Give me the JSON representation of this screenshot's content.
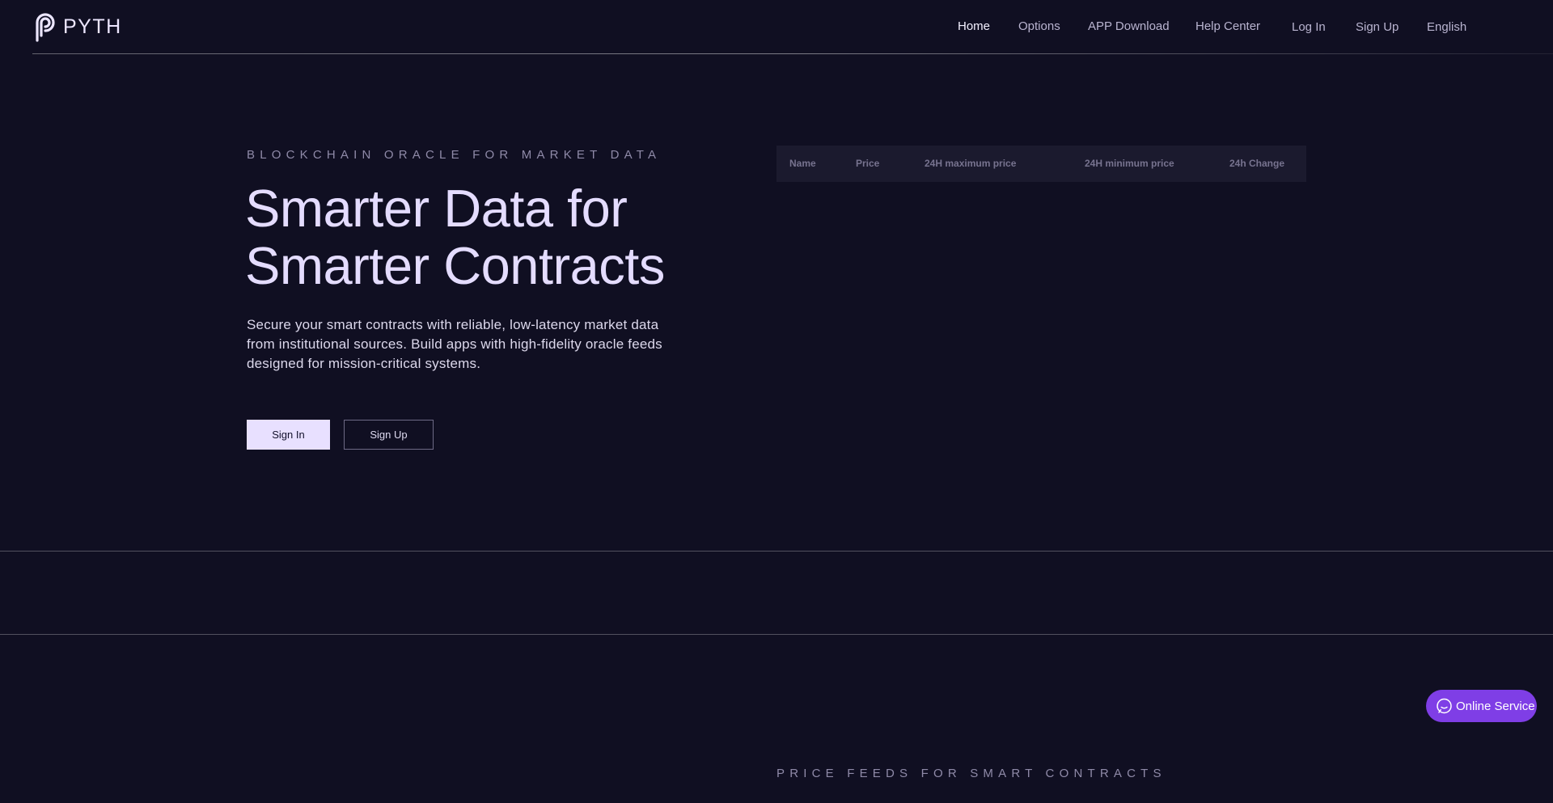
{
  "brand": {
    "name": "PYTH"
  },
  "nav": {
    "items": [
      {
        "label": "Home",
        "active": true
      },
      {
        "label": "Options",
        "active": false
      },
      {
        "label": "APP Download",
        "active": false
      },
      {
        "label": "Help Center",
        "active": false
      },
      {
        "label": "Log In",
        "active": false
      },
      {
        "label": "Sign Up",
        "active": false
      },
      {
        "label": "English",
        "active": false
      }
    ]
  },
  "hero": {
    "eyebrow": "BLOCKCHAIN ORACLE FOR MARKET DATA",
    "title_line1": "Smarter Data for",
    "title_line2": "Smarter Contracts",
    "description": "Secure your smart contracts with reliable, low-latency market data from institutional sources. Build apps with high-fidelity oracle feeds designed for mission-critical systems.",
    "sign_in_label": "Sign In",
    "sign_up_label": "Sign Up"
  },
  "market_table": {
    "columns": [
      "Name",
      "Price",
      "24H maximum price",
      "24H minimum price",
      "24h Change"
    ],
    "rows": []
  },
  "price_feeds": {
    "eyebrow": "PRICE FEEDS FOR SMART CONTRACTS"
  },
  "support": {
    "label": "Online Service"
  },
  "colors": {
    "background": "#100f22",
    "accent": "#7f3ee6",
    "title": "#e4dcff",
    "primary_button": "#e8e0ff"
  }
}
